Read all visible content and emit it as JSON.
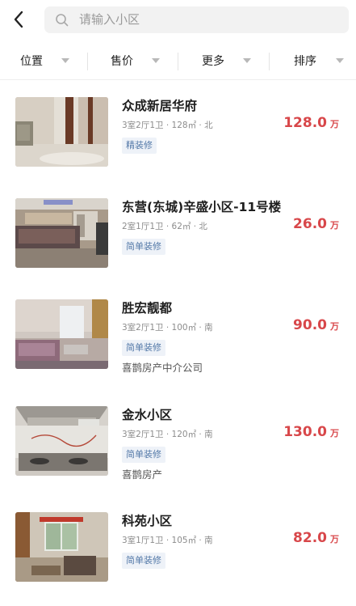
{
  "header": {
    "back_icon": "chevron-left-icon",
    "search_icon": "search-icon",
    "search_placeholder": "请输入小区"
  },
  "filters": [
    {
      "label": "位置",
      "icon": "caret-down-icon"
    },
    {
      "label": "售价",
      "icon": "caret-down-icon"
    },
    {
      "label": "更多",
      "icon": "caret-down-icon"
    },
    {
      "label": "排序",
      "icon": "caret-down-icon"
    }
  ],
  "colors": {
    "price": "#d8474a",
    "tag_bg": "#eef2f8",
    "tag_text": "#5479a8"
  },
  "listings": [
    {
      "title": "众成新居华府",
      "meta": "3室2厅1卫 · 128㎡ · 北",
      "tag": "精装修",
      "agency": "",
      "price": "128.0",
      "unit": "万"
    },
    {
      "title": "东营(东城)辛盛小区-11号楼",
      "meta": "2室1厅1卫 · 62㎡ · 北",
      "tag": "简单装修",
      "agency": "",
      "price": "26.0",
      "unit": "万"
    },
    {
      "title": "胜宏靓都",
      "meta": "3室2厅1卫 · 100㎡ · 南",
      "tag": "简单装修",
      "agency": "喜鹊房产中介公司",
      "price": "90.0",
      "unit": "万"
    },
    {
      "title": "金水小区",
      "meta": "3室2厅1卫 · 120㎡ · 南",
      "tag": "简单装修",
      "agency": "喜鹊房产",
      "price": "130.0",
      "unit": "万"
    },
    {
      "title": "科苑小区",
      "meta": "3室1厅1卫 · 105㎡ · 南",
      "tag": "简单装修",
      "agency": "",
      "price": "82.0",
      "unit": "万"
    }
  ]
}
